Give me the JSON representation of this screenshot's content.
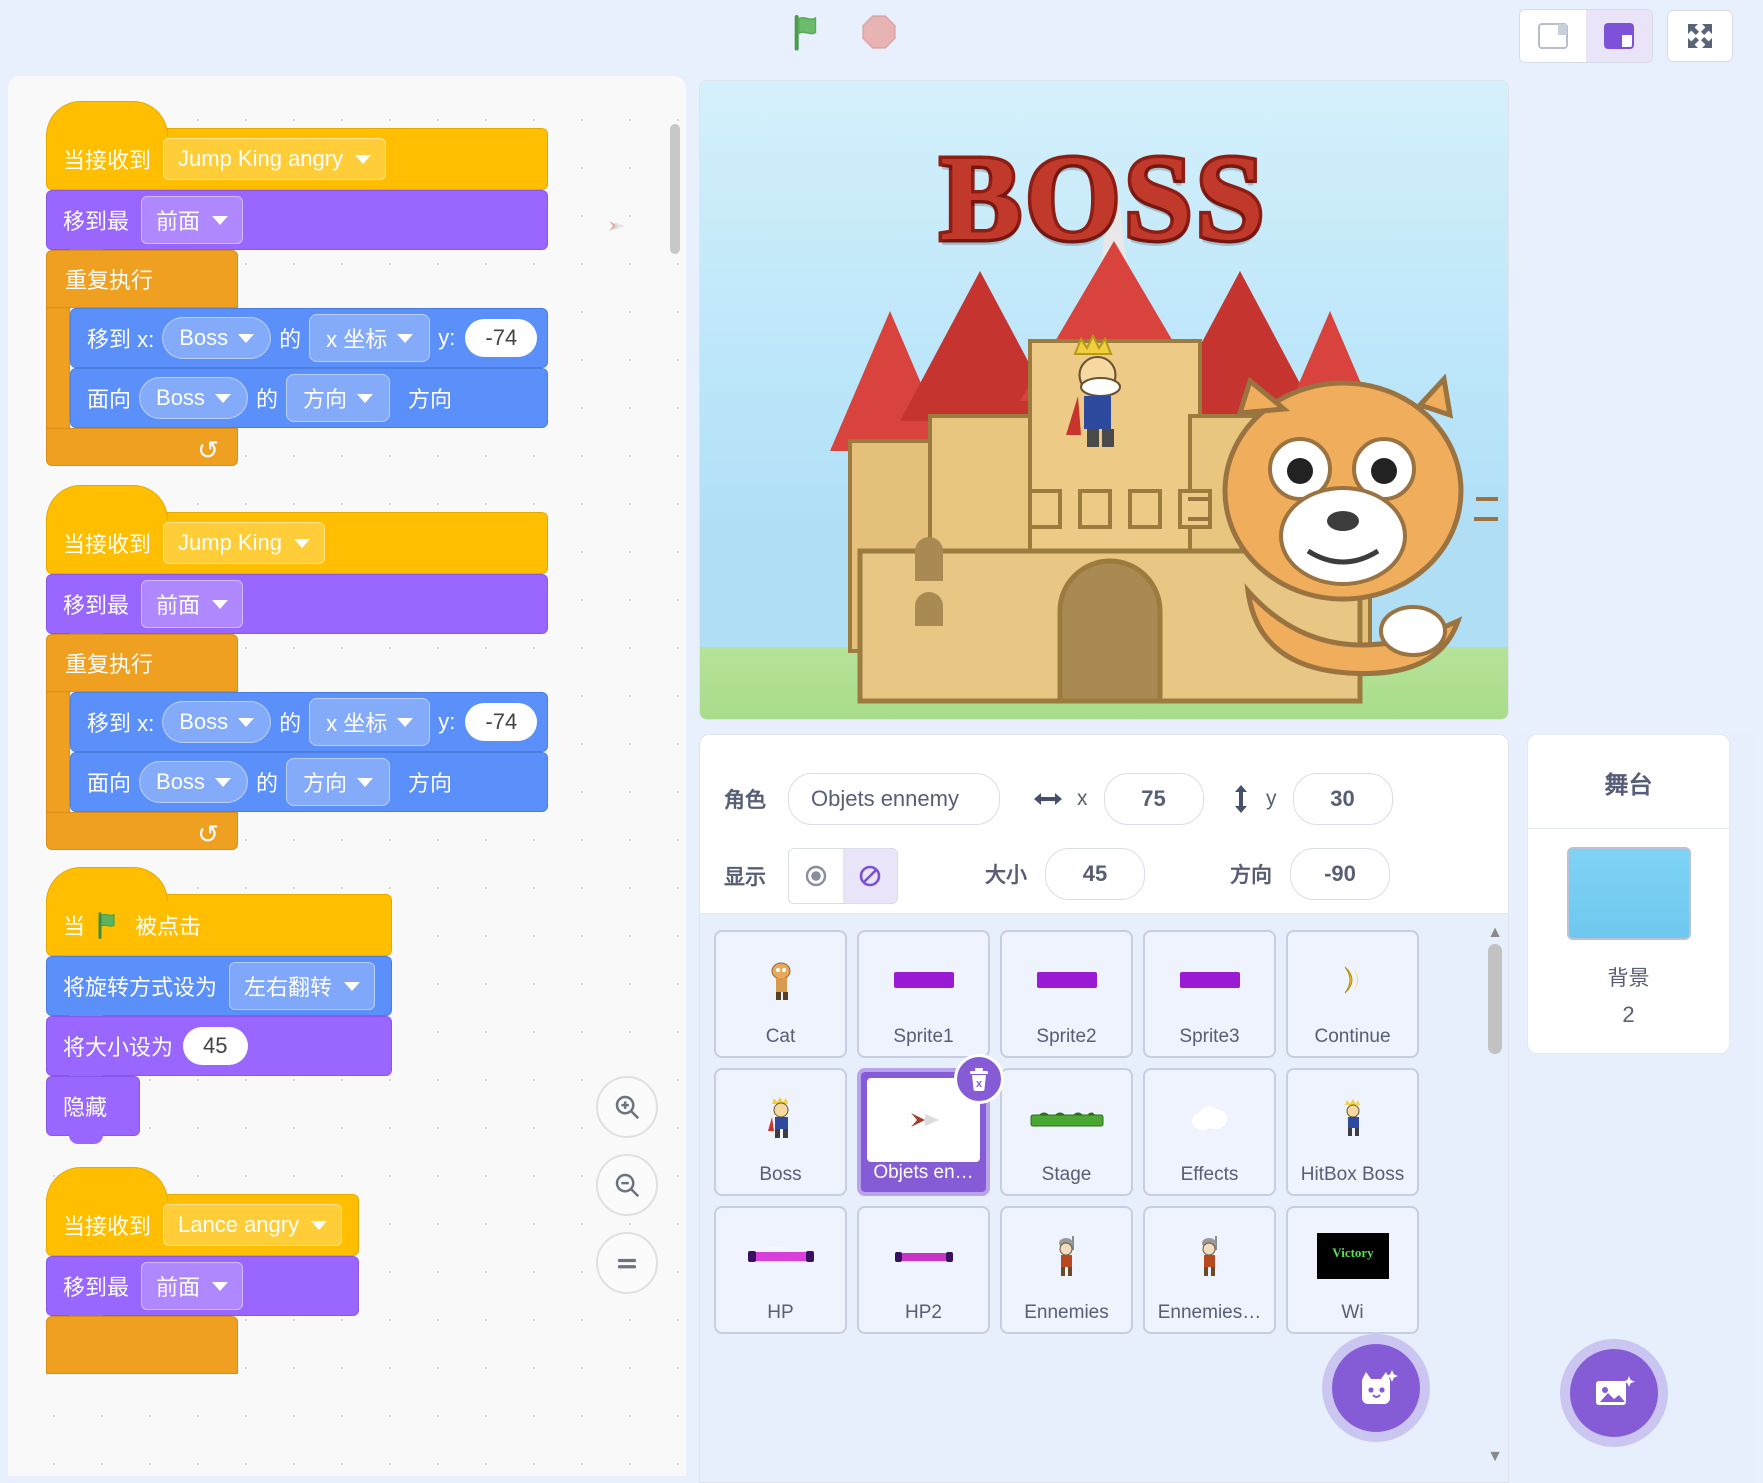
{
  "toolbar": {
    "green_flag_icon": "green-flag-icon",
    "stop_icon": "stop-sign-icon",
    "small_stage_icon": "small-stage-layout-icon",
    "large_stage_icon": "large-stage-layout-icon",
    "fullscreen_icon": "fullscreen-icon"
  },
  "code": {
    "zoom_in_icon": "zoom-in-icon",
    "zoom_out_icon": "zoom-out-icon",
    "zoom_reset_icon": "zoom-reset-icon",
    "scripts": [
      {
        "hat_label": "当接收到",
        "hat_value": "Jump King angry",
        "b1_label": "移到最",
        "b1_value": "前面",
        "c_label": "重复执行",
        "m1_prefix": "移到 x:",
        "m1_obj": "Boss",
        "m1_de": "的",
        "m1_prop": "x 坐标",
        "m1_ylabel": "y:",
        "m1_yval": "-74",
        "m2_prefix": "面向",
        "m2_obj": "Boss",
        "m2_de": "的",
        "m2_prop": "方向",
        "m2_suffix": "方向"
      },
      {
        "hat_label": "当接收到",
        "hat_value": "Jump King",
        "b1_label": "移到最",
        "b1_value": "前面",
        "c_label": "重复执行",
        "m1_prefix": "移到 x:",
        "m1_obj": "Boss",
        "m1_de": "的",
        "m1_prop": "x 坐标",
        "m1_ylabel": "y:",
        "m1_yval": "-74",
        "m2_prefix": "面向",
        "m2_obj": "Boss",
        "m2_de": "的",
        "m2_prop": "方向",
        "m2_suffix": "方向"
      }
    ],
    "flag_script": {
      "hat_when": "当",
      "hat_clicked": "被点击",
      "rot_label": "将旋转方式设为",
      "rot_value": "左右翻转",
      "size_label": "将大小设为",
      "size_value": "45",
      "hide_label": "隐藏"
    },
    "lance_script": {
      "hat_label": "当接收到",
      "hat_value": "Lance angry",
      "b1_label": "移到最",
      "b1_value": "前面"
    }
  },
  "stage": {
    "boss_title": "BOSS"
  },
  "sprite_info": {
    "name_label": "角色",
    "name_value": "Objets ennemy",
    "x_label": "x",
    "x_value": "75",
    "y_label": "y",
    "y_value": "30",
    "show_label": "显示",
    "size_label": "大小",
    "size_value": "45",
    "direction_label": "方向",
    "direction_value": "-90",
    "show_icon": "eye-show-icon",
    "hide_icon": "eye-hide-icon",
    "x_arrow_icon": "horizontal-arrow-icon",
    "y_arrow_icon": "vertical-arrow-icon"
  },
  "sprite_list": {
    "delete_icon": "trash-icon",
    "add_sprite_icon": "add-sprite-cat-icon",
    "sprites": [
      {
        "name": "Cat",
        "thumb": "cat-thumb",
        "selected": false
      },
      {
        "name": "Sprite1",
        "thumb": "purple-bar-thumb",
        "selected": false
      },
      {
        "name": "Sprite2",
        "thumb": "purple-bar-thumb",
        "selected": false
      },
      {
        "name": "Sprite3",
        "thumb": "purple-bar-thumb",
        "selected": false
      },
      {
        "name": "Continue",
        "thumb": "yellow-shell-thumb",
        "selected": false
      },
      {
        "name": "Boss",
        "thumb": "boss-king-thumb",
        "selected": false
      },
      {
        "name": "Objets en…",
        "thumb": "arrow-thumb",
        "selected": true
      },
      {
        "name": "Stage",
        "thumb": "green-platform-thumb",
        "selected": false
      },
      {
        "name": "Effects",
        "thumb": "white-cloud-thumb",
        "selected": false
      },
      {
        "name": "HitBox Boss",
        "thumb": "hitbox-king-thumb",
        "selected": false
      },
      {
        "name": "HP",
        "thumb": "pink-bar-thumb",
        "selected": false
      },
      {
        "name": "HP2",
        "thumb": "magenta-bar-thumb",
        "selected": false
      },
      {
        "name": "Ennemies",
        "thumb": "knight-thumb",
        "selected": false
      },
      {
        "name": "Ennemies…",
        "thumb": "knight-thumb",
        "selected": false
      },
      {
        "name": "Wi",
        "thumb": "victory-black-thumb",
        "selected": false
      }
    ]
  },
  "stage_panel": {
    "title": "舞台",
    "backdrop_label": "背景",
    "backdrop_count": "2",
    "add_backdrop_icon": "add-backdrop-icon"
  }
}
